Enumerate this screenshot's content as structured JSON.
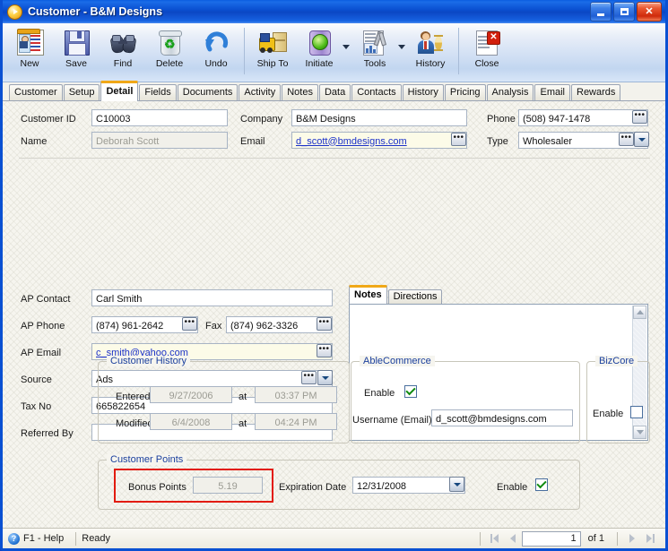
{
  "window": {
    "title": "Customer - B&M Designs",
    "app_icon": "play-circle-icon",
    "controls": {
      "minimize": "Minimize",
      "maximize": "Maximize",
      "close": "Close"
    }
  },
  "toolbar": {
    "buttons": [
      {
        "label": "New",
        "icon": "new-record-icon"
      },
      {
        "label": "Save",
        "icon": "floppy-disk-icon"
      },
      {
        "label": "Find",
        "icon": "binoculars-icon"
      },
      {
        "label": "Delete",
        "icon": "recycle-bin-icon"
      },
      {
        "label": "Undo",
        "icon": "undo-arrow-icon"
      },
      {
        "label": "Ship To",
        "icon": "forklift-icon"
      },
      {
        "label": "Initiate",
        "icon": "traffic-light-icon"
      },
      {
        "label": "Tools",
        "icon": "tools-icon"
      },
      {
        "label": "History",
        "icon": "person-hourglass-icon"
      },
      {
        "label": "Close",
        "icon": "document-close-icon"
      }
    ]
  },
  "tabs": [
    {
      "label": "Customer",
      "active": false
    },
    {
      "label": "Setup",
      "active": false
    },
    {
      "label": "Detail",
      "active": true
    },
    {
      "label": "Fields",
      "active": false
    },
    {
      "label": "Documents",
      "active": false
    },
    {
      "label": "Activity",
      "active": false
    },
    {
      "label": "Notes",
      "active": false
    },
    {
      "label": "Data",
      "active": false
    },
    {
      "label": "Contacts",
      "active": false
    },
    {
      "label": "History",
      "active": false
    },
    {
      "label": "Pricing",
      "active": false
    },
    {
      "label": "Analysis",
      "active": false
    },
    {
      "label": "Email",
      "active": false
    },
    {
      "label": "Rewards",
      "active": false
    }
  ],
  "header": {
    "customer_id_label": "Customer ID",
    "customer_id_value": "C10003",
    "name_label": "Name",
    "name_value": "Deborah  Scott",
    "company_label": "Company",
    "company_value": "B&M Designs",
    "email_label": "Email",
    "email_value": "d_scott@bmdesigns.com",
    "phone_label": "Phone",
    "phone_value": "(508) 947-1478",
    "type_label": "Type",
    "type_value": "Wholesaler"
  },
  "details": {
    "ap_contact_label": "AP Contact",
    "ap_contact_value": "Carl Smith",
    "ap_phone_label": "AP Phone",
    "ap_phone_value": "(874) 961-2642",
    "fax_label": "Fax",
    "fax_value": "(874) 962-3326",
    "ap_email_label": "AP Email",
    "ap_email_value": "c_smith@yahoo.com",
    "source_label": "Source",
    "source_value": "Ads",
    "tax_no_label": "Tax No",
    "tax_no_value": "665822654",
    "referred_by_label": "Referred By",
    "referred_by_value": ""
  },
  "notes_panel": {
    "tabs": [
      {
        "label": "Notes",
        "active": true
      },
      {
        "label": "Directions",
        "active": false
      }
    ],
    "content": ""
  },
  "customer_history": {
    "caption": "Customer History",
    "entered_label": "Entered",
    "entered_date": "9/27/2006",
    "entered_at_label": "at",
    "entered_time": "03:37 PM",
    "modified_label": "Modified",
    "modified_date": "6/4/2008",
    "modified_at_label": "at",
    "modified_time": "04:24 PM"
  },
  "ablecommerce": {
    "caption": "AbleCommerce",
    "enable_label": "Enable",
    "enable_checked": true,
    "username_label": "Username (Email)",
    "username_value": "d_scott@bmdesigns.com"
  },
  "bizcore": {
    "caption": "BizCore",
    "enable_label": "Enable",
    "enable_checked": false
  },
  "customer_points": {
    "caption": "Customer Points",
    "bonus_points_label": "Bonus Points",
    "bonus_points_value": "5.19",
    "expiration_date_label": "Expiration Date",
    "expiration_date_value": "12/31/2008",
    "enable_label": "Enable",
    "enable_checked": true,
    "highlight_color": "#e21b0c"
  },
  "status_bar": {
    "help_label": "F1 - Help",
    "help_icon": "question-circle-icon",
    "state": "Ready",
    "page_value": "1",
    "of_label": "of  1"
  }
}
